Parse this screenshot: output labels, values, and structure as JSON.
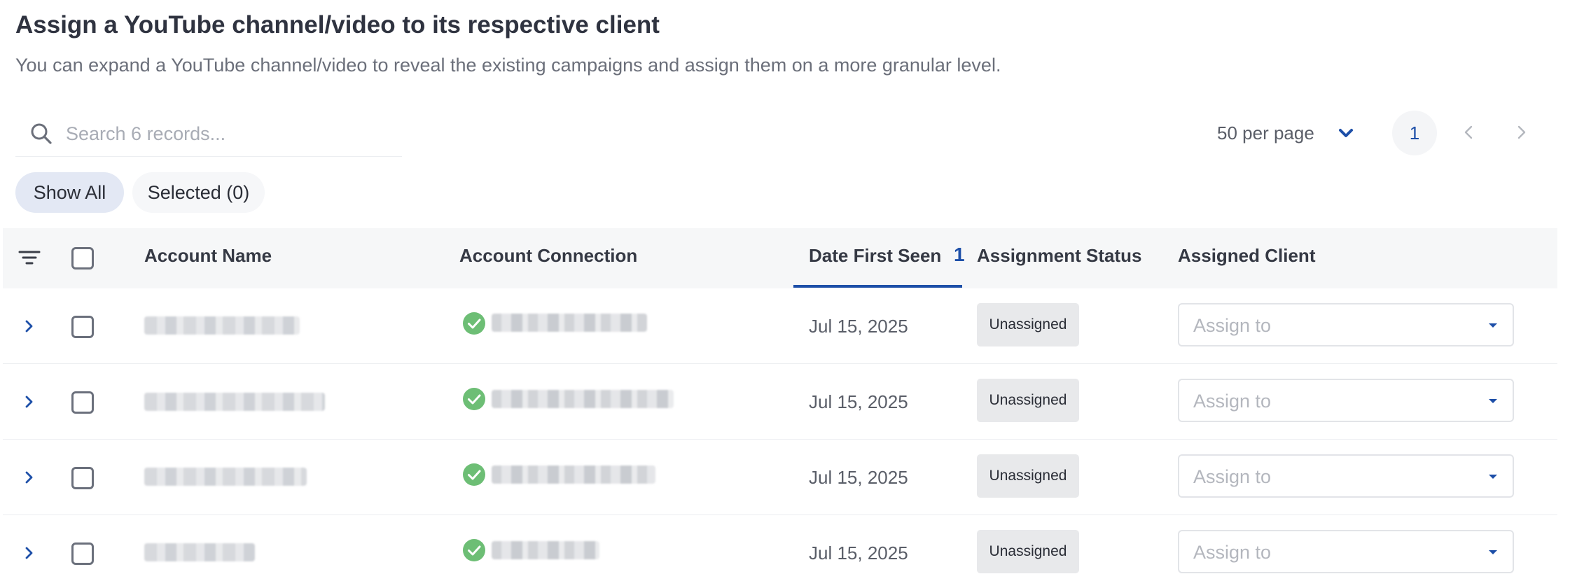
{
  "header": {
    "title": "Assign a YouTube channel/video to its respective client",
    "subtitle": "You can expand a YouTube channel/video to reveal the existing campaigns and assign them on a more granular level."
  },
  "search": {
    "placeholder": "Search 6 records...",
    "value": ""
  },
  "pagination": {
    "per_page_label": "50 per page",
    "current_page": "1"
  },
  "filters": {
    "show_all": "Show All",
    "selected": "Selected (0)"
  },
  "table": {
    "columns": {
      "account_name": "Account Name",
      "account_connection": "Account Connection",
      "date_first_seen": "Date First Seen",
      "assignment_status": "Assignment Status",
      "assigned_client": "Assigned Client"
    },
    "sort_priority": "1",
    "rows": [
      {
        "date": "Jul 15, 2025",
        "status": "Unassigned",
        "assign_placeholder": "Assign to"
      },
      {
        "date": "Jul 15, 2025",
        "status": "Unassigned",
        "assign_placeholder": "Assign to"
      },
      {
        "date": "Jul 15, 2025",
        "status": "Unassigned",
        "assign_placeholder": "Assign to"
      },
      {
        "date": "Jul 15, 2025",
        "status": "Unassigned",
        "assign_placeholder": "Assign to"
      }
    ]
  },
  "colors": {
    "accent": "#1d4fa8",
    "connected_green": "#6dbe75",
    "badge_bg": "#e8e9eb",
    "header_bg": "#f6f7f8"
  },
  "icons": [
    "search-icon",
    "chevron-down-icon",
    "chevron-left-icon",
    "chevron-right-icon",
    "filter-icon",
    "expand-chevron-icon",
    "check-circle-icon",
    "caret-down-icon"
  ]
}
